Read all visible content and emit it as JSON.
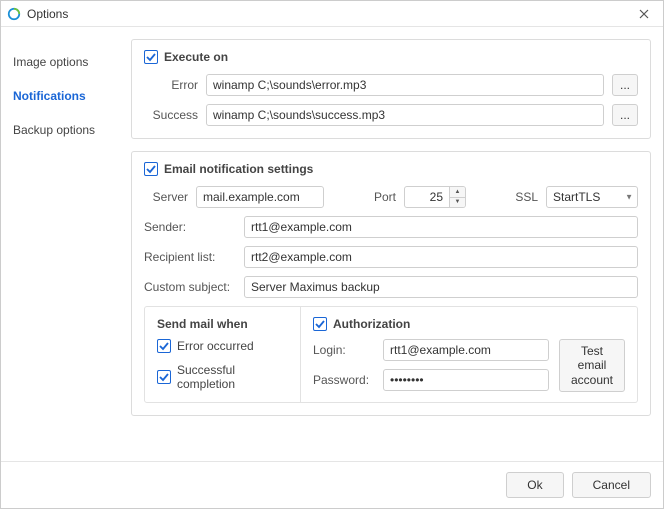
{
  "window": {
    "title": "Options"
  },
  "sidebar": {
    "items": [
      {
        "label": "Image options"
      },
      {
        "label": "Notifications"
      },
      {
        "label": "Backup options"
      }
    ]
  },
  "execute": {
    "title": "Execute on",
    "error_label": "Error",
    "error_value": "winamp C;\\sounds\\error.mp3",
    "success_label": "Success",
    "success_value": "winamp C;\\sounds\\success.mp3",
    "browse": "..."
  },
  "email": {
    "title": "Email notification settings",
    "server_label": "Server",
    "server_value": "mail.example.com",
    "port_label": "Port",
    "port_value": "25",
    "ssl_label": "SSL",
    "ssl_value": "StartTLS",
    "sender_label": "Sender:",
    "sender_value": "rtt1@example.com",
    "recipient_label": "Recipient list:",
    "recipient_value": "rtt2@example.com",
    "subject_label": "Custom subject:",
    "subject_value": "Server Maximus backup",
    "send_when": {
      "title": "Send mail when",
      "error": "Error occurred",
      "success": "Successful completion"
    },
    "auth": {
      "title": "Authorization",
      "login_label": "Login:",
      "login_value": "rtt1@example.com",
      "password_label": "Password:",
      "password_value": "••••••••",
      "test_label": "Test email account"
    }
  },
  "footer": {
    "ok": "Ok",
    "cancel": "Cancel"
  }
}
